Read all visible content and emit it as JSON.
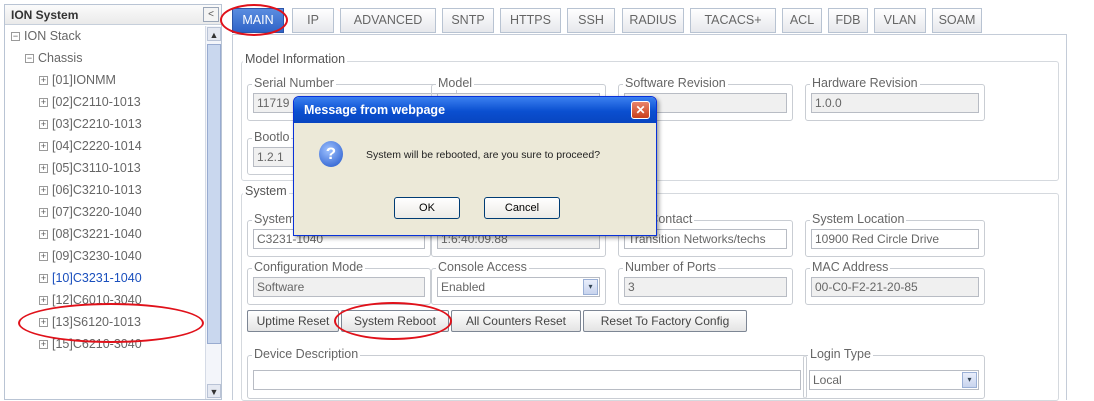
{
  "sidebar": {
    "title": "ION System",
    "collapse_glyph": "<",
    "items": [
      {
        "label": "ION Stack",
        "toggle": "−"
      },
      {
        "label": "Chassis",
        "toggle": "−"
      },
      {
        "label": "[01]IONMM",
        "toggle": "+"
      },
      {
        "label": "[02]C2110-1013",
        "toggle": "+"
      },
      {
        "label": "[03]C2210-1013",
        "toggle": "+"
      },
      {
        "label": "[04]C2220-1014",
        "toggle": "+"
      },
      {
        "label": "[05]C3110-1013",
        "toggle": "+"
      },
      {
        "label": "[06]C3210-1013",
        "toggle": "+"
      },
      {
        "label": "[07]C3220-1040",
        "toggle": "+"
      },
      {
        "label": "[08]C3221-1040",
        "toggle": "+"
      },
      {
        "label": "[09]C3230-1040",
        "toggle": "+"
      },
      {
        "label": "[10]C3231-1040",
        "toggle": "+"
      },
      {
        "label": "[12]C6010-3040",
        "toggle": "+"
      },
      {
        "label": "[13]S6120-1013",
        "toggle": "+"
      },
      {
        "label": "[15]C6210-3040",
        "toggle": "+"
      }
    ],
    "selected_index": 11,
    "scroll_up": "▲",
    "scroll_down": "▼"
  },
  "tabs": [
    "MAIN",
    "IP",
    "ADVANCED",
    "SNTP",
    "HTTPS",
    "SSH",
    "RADIUS",
    "TACACS+",
    "ACL",
    "FDB",
    "VLAN",
    "SOAM"
  ],
  "active_tab": "MAIN",
  "model_info": {
    "title": "Model Information",
    "serial_label": "Serial Number",
    "serial_value": "11719",
    "model_label": "Model",
    "model_value": "",
    "sw_label": "Software Revision",
    "sw_value": "",
    "hw_label": "Hardware Revision",
    "hw_value": "1.0.0",
    "boot_label": "Bootlo",
    "boot_value": "1.2.1"
  },
  "system": {
    "title": "System",
    "name_label": "System",
    "name_value": "C3231-1040",
    "uptime_value": "1:6:40:09.88",
    "contact_label": "tem Contact",
    "contact_value": "Transition Networks/techs",
    "location_label": "System Location",
    "location_value": "10900 Red Circle Drive",
    "config_label": "Configuration Mode",
    "config_value": "Software",
    "console_label": "Console Access",
    "console_value": "Enabled",
    "ports_label": "Number of Ports",
    "ports_value": "3",
    "mac_label": "MAC Address",
    "mac_value": "00-C0-F2-21-20-85"
  },
  "buttons": {
    "uptime_reset": "Uptime Reset",
    "system_reboot": "System Reboot",
    "counters_reset": "All Counters Reset",
    "factory_reset": "Reset To Factory Config"
  },
  "description": {
    "label": "Device Description",
    "value": "",
    "login_label": "Login Type",
    "login_value": "Local"
  },
  "dialog": {
    "title": "Message from webpage",
    "message": "System will be rebooted, are you sure to proceed?",
    "ok": "OK",
    "cancel": "Cancel",
    "close_glyph": "✕",
    "icon_glyph": "?"
  },
  "dropdown_glyph": "▾",
  "colors": {
    "active_tab": "#2f63c7",
    "highlight_circle": "#e0111a",
    "dialog_titlebar": "#0a4fd0"
  }
}
